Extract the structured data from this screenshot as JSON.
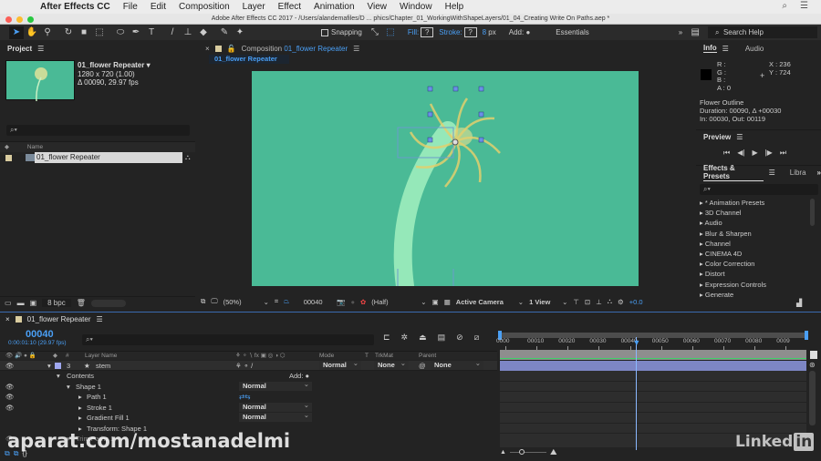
{
  "menubar": {
    "app_name": "After Effects CC",
    "items": [
      "File",
      "Edit",
      "Composition",
      "Layer",
      "Effect",
      "Animation",
      "View",
      "Window",
      "Help"
    ]
  },
  "window_title": "Adobe After Effects CC 2017 - /Users/alandemafiles/D ... phics/Chapter_01_WorkingWithShapeLayers/01_04_Creating Write On Paths.aep *",
  "toolbar": {
    "snapping_label": "Snapping",
    "fill_label": "Fill:",
    "stroke_label": "Stroke:",
    "unknown_value": "?",
    "stroke_width": "8",
    "stroke_unit": "px",
    "add_label": "Add:",
    "workspace": "Essentials",
    "more": "»",
    "search_placeholder": "Search Help"
  },
  "project": {
    "title": "Project",
    "item_name": "01_flower Repeater ▾",
    "resolution": "1280 x 720 (1.00)",
    "duration": "Δ 00090, 29.97 fps",
    "name_column": "Name",
    "items": [
      {
        "name": "01_flower Repeater"
      }
    ],
    "bpc": "8 bpc"
  },
  "composition": {
    "panel_label": "Composition",
    "comp_name": "01_flower Repeater",
    "tab_label": "01_flower Repeater",
    "zoom": "(50%)",
    "timecode": "00040",
    "resolution": "(Half)",
    "camera": "Active Camera",
    "views": "1 View",
    "exposure": "+0.0"
  },
  "info": {
    "tab_info": "Info",
    "tab_audio": "Audio",
    "r": "R :",
    "g": "G :",
    "b": "B :",
    "a": "A : 0",
    "x": "X : 236",
    "y": "Y : 724",
    "layer_name": "Flower Outline",
    "duration": "Duration: 00090, Δ +00030",
    "in_out": "In: 00030, Out: 00119"
  },
  "preview": {
    "title": "Preview"
  },
  "effects": {
    "title": "Effects & Presets",
    "tab_libra": "Libra",
    "items": [
      "* Animation Presets",
      "3D Channel",
      "Audio",
      "Blur & Sharpen",
      "Channel",
      "CINEMA 4D",
      "Color Correction",
      "Distort",
      "Expression Controls",
      "Generate"
    ]
  },
  "timeline": {
    "comp_name": "01_flower Repeater",
    "current_frame": "00040",
    "current_time": "0:00:01:10 (29.97 fps)",
    "col_hash": "#",
    "col_layer_name": "Layer Name",
    "col_mode": "Mode",
    "col_t": "T",
    "col_trkmat": "TrkMat",
    "col_parent": "Parent",
    "layer": {
      "index": "3",
      "name": "stem",
      "mode": "Normal",
      "trkmat": "None",
      "parent": "None"
    },
    "contents_label": "Contents",
    "add_label": "Add:",
    "rows": [
      {
        "label": "Shape 1",
        "mode": "Normal"
      },
      {
        "label": "Path 1",
        "mode": ""
      },
      {
        "label": "Stroke 1",
        "mode": "Normal"
      },
      {
        "label": "Gradient Fill 1",
        "mode": "Normal"
      },
      {
        "label": "Transform: Shape 1",
        "mode": ""
      },
      {
        "label": "Trim Paths 1",
        "mode": ""
      }
    ],
    "ruler": [
      "0000",
      "00010",
      "00020",
      "00030",
      "00040",
      "00050",
      "00060",
      "00070",
      "00080",
      "0009"
    ],
    "playhead_frame": 40,
    "total_frames": 90
  },
  "watermarks": {
    "left": "aparat.com/mostanadelmi",
    "right": "Linked"
  }
}
